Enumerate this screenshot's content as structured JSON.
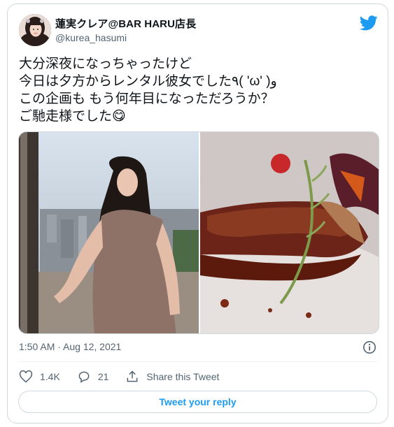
{
  "user": {
    "display_name": "蓮実クレア@BAR HARU店長",
    "handle": "@kurea_hasumi"
  },
  "tweet": {
    "lines": [
      "大分深夜になっちゃったけど",
      "今日は夕方からレンタル彼女でした٩( 'ω' )و",
      "この企画も もう何年目になっただろうか？",
      "ご馳走様でした😋"
    ],
    "timestamp": "1:50 AM · Aug 12, 2021"
  },
  "actions": {
    "likes": "1.4K",
    "replies": "21",
    "share_label": "Share this Tweet"
  },
  "reply_button_label": "Tweet your reply",
  "colors": {
    "twitter_blue": "#1d9bf0",
    "secondary_text": "#536471",
    "border": "#cfd9de"
  },
  "icons": [
    "twitter-bird-icon",
    "info-icon",
    "heart-icon",
    "reply-icon",
    "share-icon"
  ]
}
